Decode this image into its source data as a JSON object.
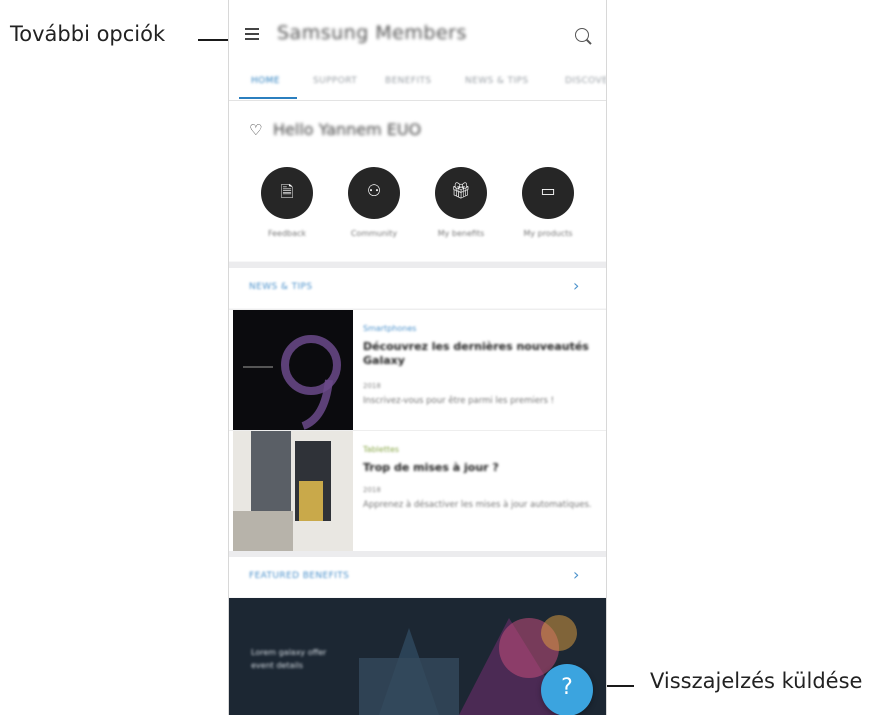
{
  "callouts": {
    "left": "További opciók",
    "right": "Visszajelzés küldése"
  },
  "app": {
    "title": "Samsung Members",
    "menu_icon": "hamburger-menu-icon",
    "search_icon": "search-icon"
  },
  "tabs": [
    {
      "label": "HOME",
      "active": true
    },
    {
      "label": "SUPPORT",
      "active": false
    },
    {
      "label": "BENEFITS",
      "active": false
    },
    {
      "label": "NEWS & TIPS",
      "active": false
    },
    {
      "label": "DISCOVER",
      "active": false
    }
  ],
  "greeting": {
    "icon": "heart-person-icon",
    "text": "Hello Yannem EUO"
  },
  "quick_actions": [
    {
      "label": "Feedback",
      "icon": "document-icon"
    },
    {
      "label": "Community",
      "icon": "people-icon"
    },
    {
      "label": "My benefits",
      "icon": "gift-icon"
    },
    {
      "label": "My products",
      "icon": "devices-icon"
    }
  ],
  "news_section": {
    "title": "NEWS & TIPS",
    "articles": [
      {
        "category": "Smartphones",
        "title": "Découvrez les dernières nouveautés Galaxy",
        "date": "2018",
        "description": "Inscrivez-vous pour être parmi les premiers !"
      },
      {
        "category": "Tablettes",
        "title": "Trop de mises à jour ?",
        "date": "2018",
        "description": "Apprenez à désactiver les mises à jour automatiques."
      }
    ]
  },
  "benefits_section": {
    "title": "FEATURED BENEFITS",
    "banner_text": "Lorem galaxy offer event details"
  },
  "fab": {
    "label": "?",
    "color": "#3ba4df"
  },
  "colors": {
    "accent": "#2b7fbf",
    "link": "#4e93cc",
    "dark_circle": "#262626"
  }
}
